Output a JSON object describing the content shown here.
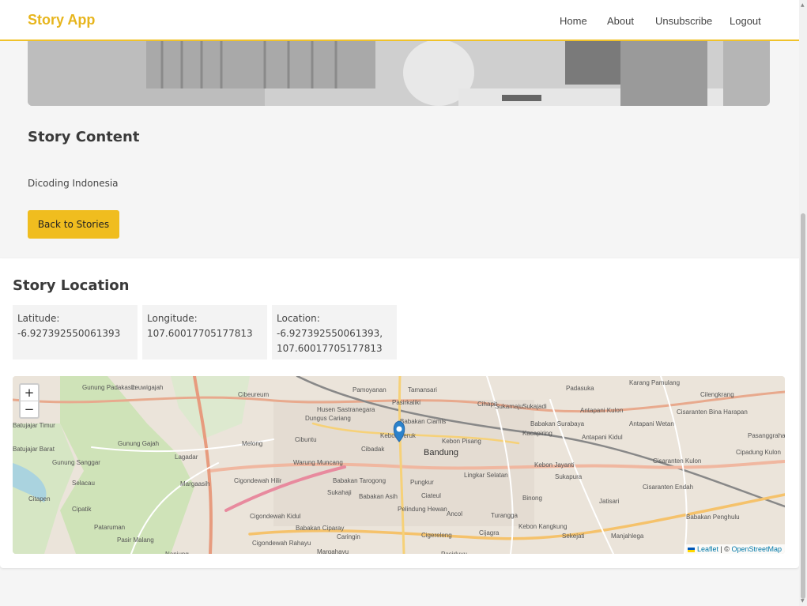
{
  "nav": {
    "brand": "Story App",
    "links": [
      "Home",
      "About",
      "Unsubscribe",
      "Logout"
    ]
  },
  "story": {
    "content_title": "Story Content",
    "body": "Dicoding Indonesia",
    "back_label": "Back to Stories"
  },
  "location": {
    "title": "Story Location",
    "latitude_label": "Latitude:",
    "latitude": "-6.927392550061393",
    "longitude_label": "Longitude:",
    "longitude": "107.60017705177813",
    "location_label": "Location:",
    "location_line1": "-6.927392550061393,",
    "location_line2": "107.60017705177813"
  },
  "map": {
    "zoom_in": "+",
    "zoom_out": "−",
    "attribution_leaflet": "Leaflet",
    "attribution_sep": " | © ",
    "attribution_osm": "OpenStreetMap",
    "place_labels": [
      "Leuwigajah",
      "Cibeureum",
      "Pamoyanan",
      "Tamansari",
      "Padasuka",
      "Karang Pamulang",
      "Cilengkrang",
      "Gunung Padakasih",
      "Husen Sastranegara",
      "Pasirkaliki",
      "Cihapit",
      "Sukamaju",
      "Sukajadi",
      "Dungus Cariang",
      "Babakan Ciamis",
      "Babakan Surabaya",
      "Antapani Kulon",
      "Antapani Wetan",
      "Cisaranten Bina Harapan",
      "Batujajar Timur",
      "Kebon Jeruk",
      "Kebon Pisang",
      "Kacapiring",
      "Melong",
      "Cibuntu",
      "Cibadak",
      "Bandung",
      "Antapani Kidul",
      "Pasanggrahan",
      "Batujajar Barat",
      "Gunung Gajah",
      "Lagadar",
      "Warung Muncang",
      "Kebon Jayanti",
      "Cisaranten Kulon",
      "Cipadung Kulon",
      "Gunung Sanggar",
      "Margaasih",
      "Cigondewah Hilir",
      "Babakan Tarogong",
      "Pungkur",
      "Lingkar Selatan",
      "Sukapura",
      "Selacau",
      "Sukahaji",
      "Babakan Asih",
      "Ciateul",
      "Binong",
      "Jatisari",
      "Cisaranten Endah",
      "Citapen",
      "Cipatik",
      "Cigondewah Kidul",
      "Pelindung Hewan",
      "Ancol",
      "Turangga",
      "Babakan Penghulu",
      "Pataruman",
      "Babakan Ciparay",
      "Caringin",
      "Cigereleng",
      "Cijagra",
      "Kebon Kangkung",
      "Sekejati",
      "Manjahlega",
      "Pasir Malang",
      "Cigondewah Rahayu",
      "Margahayu",
      "Pasirluyu",
      "Nanjung"
    ]
  },
  "colors": {
    "brand": "#e7b51d",
    "accent": "#f0bd1f",
    "marker": "#2b82cb"
  }
}
